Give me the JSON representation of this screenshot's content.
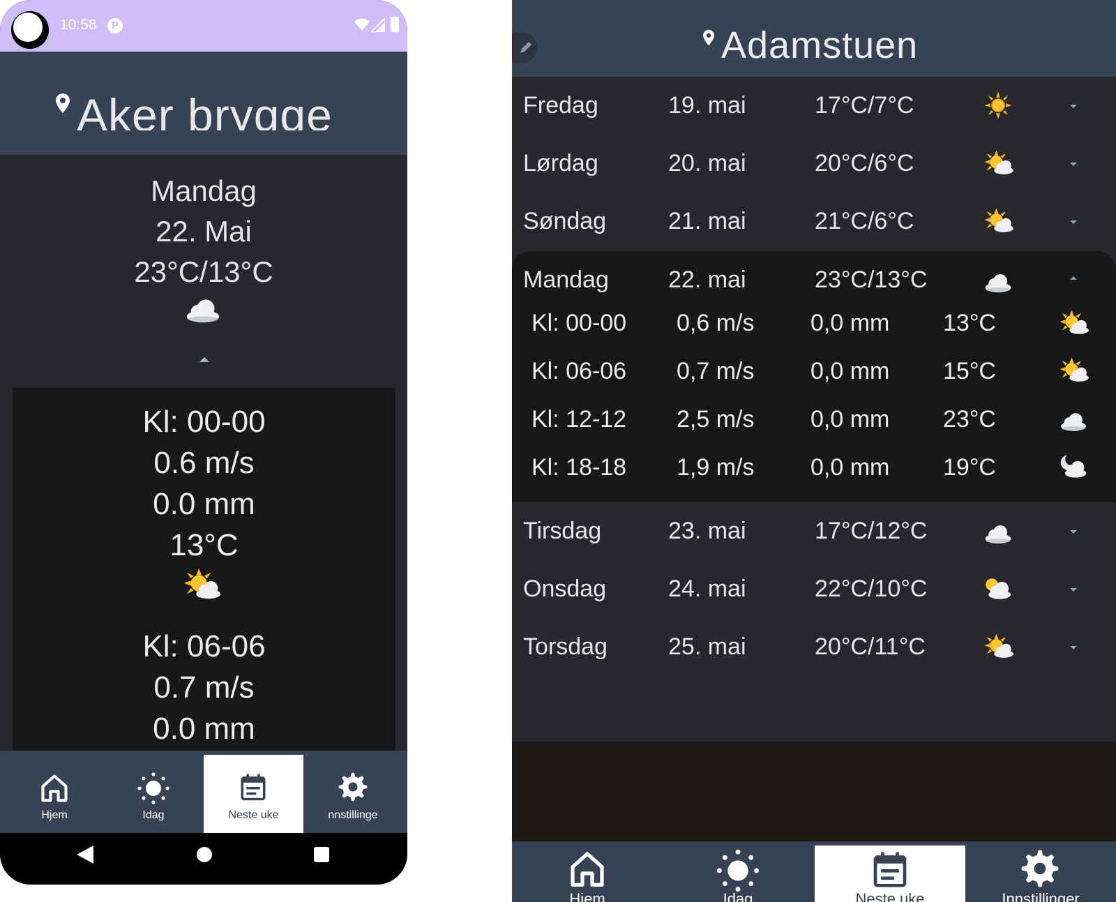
{
  "phone": {
    "status_bar": {
      "time": "10:58",
      "notification_badge": "P"
    },
    "location": "Aker brygge",
    "day": {
      "name": "Mandag",
      "date": "22. Mai",
      "temps": "23°C/13°C",
      "icon": "cloud-icon"
    },
    "hours": [
      {
        "time": "Kl: 00-00",
        "wind": "0.6 m/s",
        "rain": "0.0 mm",
        "temp": "13°C",
        "icon": "sun-cloud-icon"
      },
      {
        "time": "Kl: 06-06",
        "wind": "0.7 m/s",
        "rain": "0.0 mm"
      }
    ],
    "nav": [
      {
        "label": "Hjem",
        "icon": "home-icon"
      },
      {
        "label": "Idag",
        "icon": "sun-icon"
      },
      {
        "label": "Neste uke",
        "icon": "calendar-icon",
        "active": true
      },
      {
        "label": "nnstillinge",
        "icon": "gear-icon"
      }
    ]
  },
  "tablet": {
    "location": "Adamstuen",
    "days": [
      {
        "name": "Fredag",
        "date": "19. mai",
        "temps": "17°C/7°C",
        "icon": "sun-icon"
      },
      {
        "name": "Lørdag",
        "date": "20. mai",
        "temps": "20°C/6°C",
        "icon": "sun-cloud-icon"
      },
      {
        "name": "Søndag",
        "date": "21. mai",
        "temps": "21°C/6°C",
        "icon": "sun-cloud-icon"
      },
      {
        "name": "Mandag",
        "date": "22. mai",
        "temps": "23°C/13°C",
        "icon": "cloud-icon",
        "expanded": true
      },
      {
        "name": "Tirsdag",
        "date": "23. mai",
        "temps": "17°C/12°C",
        "icon": "cloud-icon"
      },
      {
        "name": "Onsdag",
        "date": "24. mai",
        "temps": "22°C/10°C",
        "icon": "partly-cloudy-icon"
      },
      {
        "name": "Torsdag",
        "date": "25. mai",
        "temps": "20°C/11°C",
        "icon": "sun-cloud-icon"
      }
    ],
    "hours": [
      {
        "time": "Kl: 00-00",
        "wind": "0,6 m/s",
        "rain": "0,0 mm",
        "temp": "13°C",
        "icon": "sun-cloud-icon"
      },
      {
        "time": "Kl: 06-06",
        "wind": "0,7 m/s",
        "rain": "0,0 mm",
        "temp": "15°C",
        "icon": "sun-cloud-icon"
      },
      {
        "time": "Kl: 12-12",
        "wind": "2,5 m/s",
        "rain": "0,0 mm",
        "temp": "23°C",
        "icon": "cloud-icon"
      },
      {
        "time": "Kl: 18-18",
        "wind": "1,9 m/s",
        "rain": "0,0 mm",
        "temp": "19°C",
        "icon": "moon-cloud-icon"
      }
    ],
    "nav": [
      {
        "label": "Hjem",
        "icon": "home-icon"
      },
      {
        "label": "Idag",
        "icon": "sun-icon"
      },
      {
        "label": "Neste uke",
        "icon": "calendar-icon",
        "active": true
      },
      {
        "label": "Innstillinger",
        "icon": "gear-icon"
      }
    ]
  },
  "colors": {
    "header": "#374354",
    "status_bar": "#cebdf7",
    "panel": "#26282d",
    "expanded_panel": "#17181a",
    "active_tab": "#ffffff"
  }
}
